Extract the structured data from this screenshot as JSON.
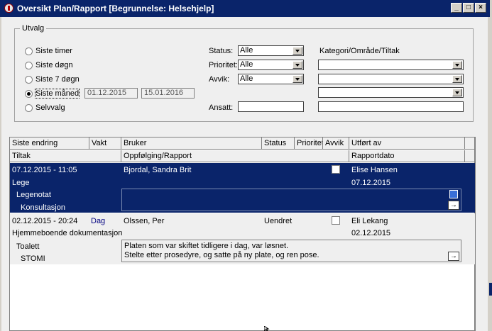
{
  "window": {
    "title": "Oversikt Plan/Rapport  [Begrunnelse: Helsehjelp]",
    "buttons": {
      "minimize": "_",
      "maximize": "□",
      "close": "×"
    }
  },
  "filter": {
    "group_label": "Utvalg",
    "periods": [
      {
        "label": "Siste timer",
        "checked": false
      },
      {
        "label": "Siste døgn",
        "checked": false
      },
      {
        "label": "Siste 7 døgn",
        "checked": false
      },
      {
        "label": "Siste måned",
        "checked": true
      },
      {
        "label": "Selvvalg",
        "checked": false
      }
    ],
    "date_from": "01.12.2015",
    "date_to": "15.01.2016",
    "status_label": "Status:",
    "status_value": "Alle",
    "prioritet_label": "Prioritet:",
    "prioritet_value": "Alle",
    "avvik_label": "Avvik:",
    "avvik_value": "Alle",
    "ansatt_label": "Ansatt:",
    "ansatt_value": "",
    "kategori_label": "Kategori/Område/Tiltak",
    "kategori_values": [
      "",
      "",
      ""
    ],
    "kategori_text": ""
  },
  "grid": {
    "headers_row1": [
      "Siste endring",
      "Vakt",
      "Bruker",
      "Status",
      "Prioritet",
      "Avvik",
      "Utført av"
    ],
    "headers_row2": [
      "Tiltak",
      "Oppfølging/Rapport",
      "Rapportdato"
    ],
    "rows": [
      {
        "selected": true,
        "datetime": "07.12.2015 - 11:05",
        "vakt": "",
        "bruker": "Bjordal, Sandra Brit",
        "status": "",
        "avvik_checked": false,
        "utfort_av": "Elise Hansen",
        "tiltak": "Lege",
        "rapportdato": "07.12.2015",
        "kategori": "Legenotat",
        "underkategori": "Konsultasjon",
        "note_line1": "",
        "note_line2": "",
        "button": "→"
      },
      {
        "selected": false,
        "datetime": "02.12.2015 - 20:24",
        "vakt": "Dag",
        "bruker": "Olssen, Per",
        "status": "Uendret",
        "avvik_checked": false,
        "utfort_av": "Eli Lekang",
        "tiltak": "Hjemmeboende dokumentasjon",
        "rapportdato": "02.12.2015",
        "kategori": "Toalett",
        "underkategori": "STOMI",
        "note_line1": "Platen som var skiftet tidligere i dag, var løsnet.",
        "note_line2": "Stelte etter prosedyre, og satte på ny plate, og ren pose.",
        "button": "→"
      }
    ]
  },
  "colors": {
    "titlebar": "#0a246a",
    "selection": "#0a246a",
    "vakt_text": "#000080"
  }
}
